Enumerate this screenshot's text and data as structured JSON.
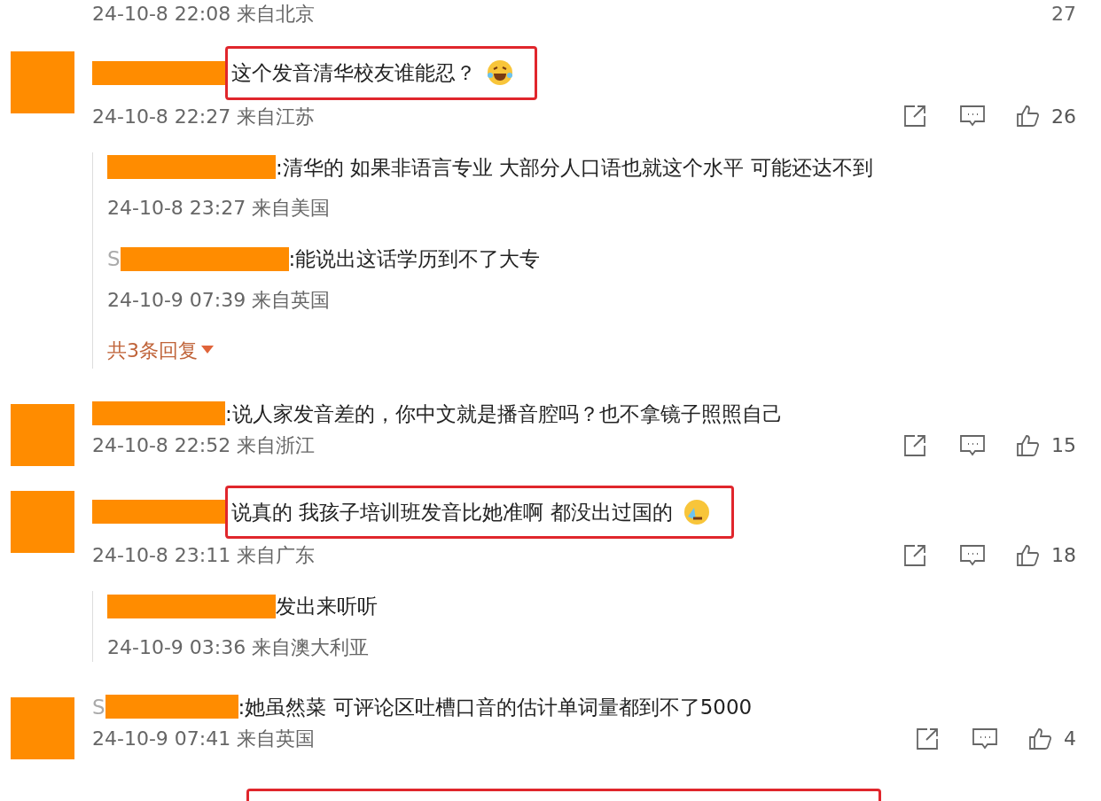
{
  "top_meta": {
    "time": "24-10-8 22:08 来自北京",
    "likes": "27"
  },
  "comments": [
    {
      "kind": "laugh",
      "text": "这个发音清华校友谁能忍？",
      "highlighted": true,
      "time": "24-10-8 22:27 来自江苏",
      "likes": "26",
      "replies": [
        {
          "text": ":清华的 如果非语言专业 大部分人口语也就这个水平 可能还达不到",
          "time": "24-10-8 23:27 来自美国"
        },
        {
          "name_fragment": "S",
          "text": ":能说出这话学历到不了大专",
          "time": "24-10-9 07:39 来自英国"
        }
      ],
      "more_replies": "共3条回复"
    },
    {
      "kind": "plain",
      "text": ":说人家发音差的，你中文就是播音腔吗？也不拿镜子照照自己",
      "highlighted": false,
      "time": "24-10-8 22:52 来自浙江",
      "likes": "15"
    },
    {
      "kind": "cry",
      "text": "说真的 我孩子培训班发音比她准啊 都没出过国的",
      "highlighted": true,
      "time": "24-10-8 23:11 来自广东",
      "likes": "18",
      "replies": [
        {
          "text": "发出来听听",
          "time": "24-10-9 03:36 来自澳大利亚"
        }
      ]
    },
    {
      "kind": "plain",
      "name_fragment": "S",
      "text": ":她虽然菜 可评论区吐槽口音的估计单词量都到不了5000",
      "highlighted": false,
      "time": "24-10-9 07:41 来自英国",
      "likes": "4"
    }
  ]
}
